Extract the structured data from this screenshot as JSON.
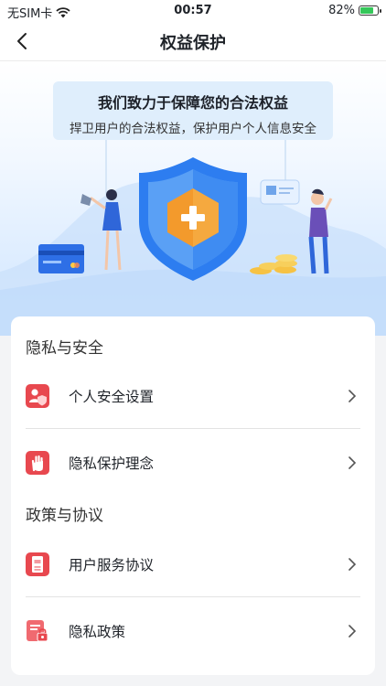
{
  "status_bar": {
    "carrier": "无SIM卡",
    "time": "00:57",
    "battery": "82%",
    "battery_level": 0.82
  },
  "nav": {
    "title": "权益保护"
  },
  "banner": {
    "title": "我们致力于保障您的合法权益",
    "subtitle": "捍卫用户的合法权益，保护用户个人信息安全"
  },
  "sections": [
    {
      "title": "隐私与安全",
      "items": [
        {
          "label": "个人安全设置",
          "icon": "user-shield-icon"
        },
        {
          "label": "隐私保护理念",
          "icon": "hand-stop-icon"
        }
      ]
    },
    {
      "title": "政策与协议",
      "items": [
        {
          "label": "用户服务协议",
          "icon": "document-icon"
        },
        {
          "label": "隐私政策",
          "icon": "document-lock-icon"
        }
      ]
    }
  ],
  "colors": {
    "accent_red": "#e8484f",
    "shield_blue": "#2d7df0",
    "shield_orange": "#f39a2c"
  }
}
